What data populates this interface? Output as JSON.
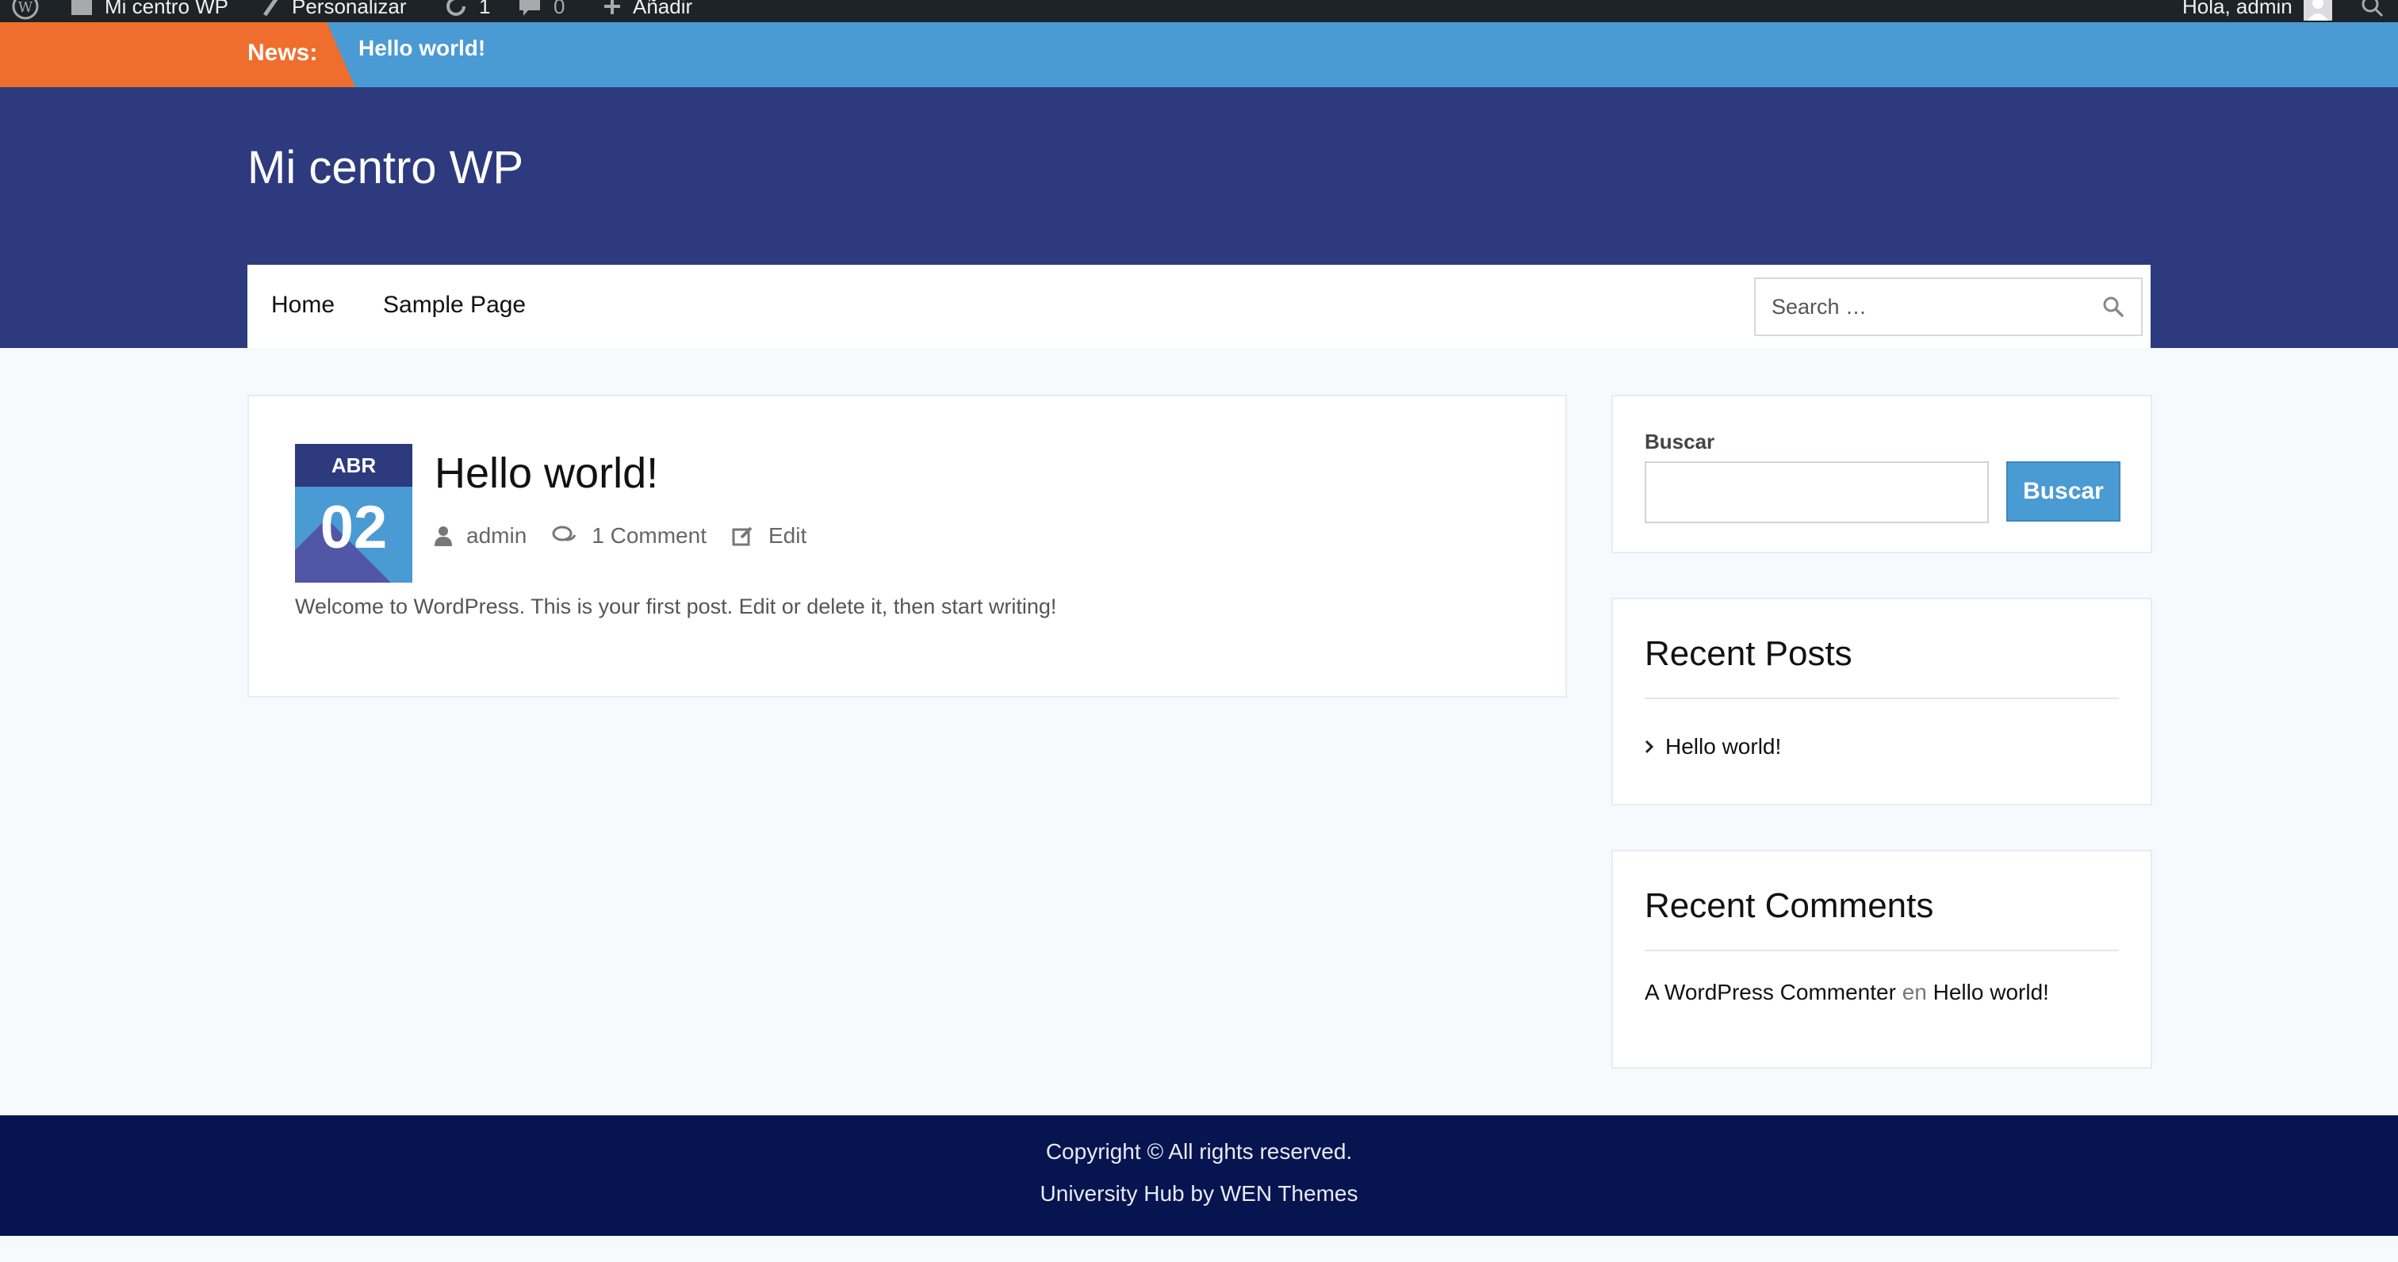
{
  "admin_bar": {
    "site_name": "Mi centro WP",
    "customize": "Personalizar",
    "updates_count": "1",
    "comments_count": "0",
    "add_new": "Añadir",
    "greeting": "Hola, admin"
  },
  "news": {
    "label": "News:",
    "items": [
      "Hello world!"
    ]
  },
  "header": {
    "site_title": "Mi centro WP"
  },
  "nav": {
    "items": [
      "Home",
      "Sample Page"
    ],
    "search_placeholder": "Search …"
  },
  "post": {
    "month": "ABR",
    "day": "02",
    "title": "Hello world!",
    "author": "admin",
    "comments": "1 Comment",
    "edit": "Edit",
    "excerpt": "Welcome to WordPress. This is your first post. Edit or delete it, then start writing!"
  },
  "sidebar": {
    "search": {
      "label": "Buscar",
      "button": "Buscar"
    },
    "recent_posts": {
      "title": "Recent Posts",
      "items": [
        "Hello world!"
      ]
    },
    "recent_comments": {
      "title": "Recent Comments",
      "items": [
        {
          "author": "A WordPress Commenter",
          "connector": "en",
          "post": "Hello world!"
        }
      ]
    }
  },
  "footer": {
    "copyright": "Copyright © All rights reserved.",
    "credit": "University Hub by WEN Themes"
  },
  "colors": {
    "admin_bar": "#1d2327",
    "news_bar": "#4a9ad4",
    "news_label": "#ef6e2d",
    "header": "#2d3a7d",
    "footer": "#061450",
    "accent": "#4a9ad4"
  }
}
